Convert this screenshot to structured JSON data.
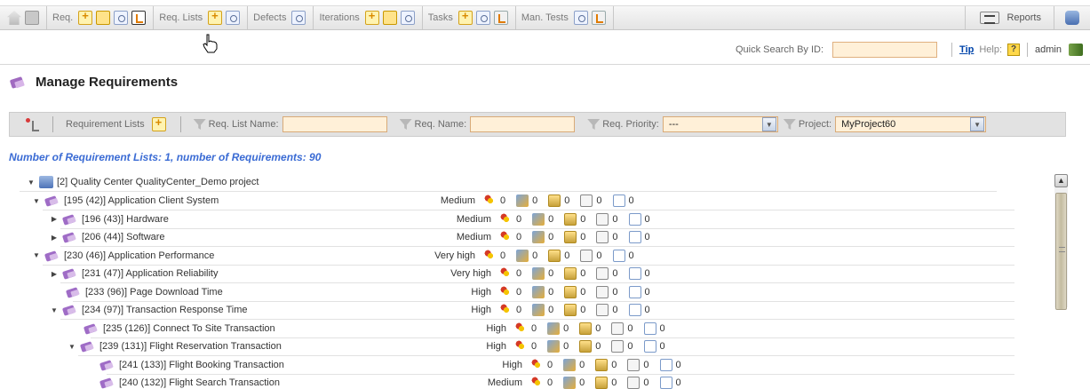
{
  "toolbar": {
    "req_label": "Req.",
    "req_lists_label": "Req. Lists",
    "defects_label": "Defects",
    "iterations_label": "Iterations",
    "tasks_label": "Tasks",
    "man_tests_label": "Man. Tests",
    "reports_label": "Reports"
  },
  "quick_search": {
    "label": "Quick Search By ID:",
    "value": "",
    "tip_label": "Tip",
    "help_label": "Help:",
    "help_icon": "?",
    "user": "admin"
  },
  "page": {
    "title": "Manage Requirements"
  },
  "filters": {
    "requirement_lists_label": "Requirement Lists",
    "req_list_name_label": "Req. List Name:",
    "req_name_label": "Req. Name:",
    "req_priority_label": "Req. Priority:",
    "req_priority_value": "---",
    "project_label": "Project:",
    "project_value": "MyProject60"
  },
  "summary": "Number of Requirement Lists: 1, number of Requirements: 90",
  "tree": {
    "root": "[2] Quality Center QualityCenter_Demo project",
    "rows": [
      {
        "label": "[195 (42)] Application Client System",
        "priority": "Medium",
        "defects": "0",
        "tests": "0",
        "tasks": "0",
        "runs": "0",
        "docs": "0"
      },
      {
        "label": "[196 (43)] Hardware",
        "priority": "Medium",
        "defects": "0",
        "tests": "0",
        "tasks": "0",
        "runs": "0",
        "docs": "0"
      },
      {
        "label": "[206 (44)] Software",
        "priority": "Medium",
        "defects": "0",
        "tests": "0",
        "tasks": "0",
        "runs": "0",
        "docs": "0"
      },
      {
        "label": "[230 (46)] Application Performance",
        "priority": "Very high",
        "defects": "0",
        "tests": "0",
        "tasks": "0",
        "runs": "0",
        "docs": "0"
      },
      {
        "label": "[231 (47)] Application Reliability",
        "priority": "Very high",
        "defects": "0",
        "tests": "0",
        "tasks": "0",
        "runs": "0",
        "docs": "0"
      },
      {
        "label": "[233 (96)] Page Download Time",
        "priority": "High",
        "defects": "0",
        "tests": "0",
        "tasks": "0",
        "runs": "0",
        "docs": "0"
      },
      {
        "label": "[234 (97)] Transaction Response Time",
        "priority": "High",
        "defects": "0",
        "tests": "0",
        "tasks": "0",
        "runs": "0",
        "docs": "0"
      },
      {
        "label": "[235 (126)] Connect To Site Transaction",
        "priority": "High",
        "defects": "0",
        "tests": "0",
        "tasks": "0",
        "runs": "0",
        "docs": "0"
      },
      {
        "label": "[239 (131)] Flight Reservation Transaction",
        "priority": "High",
        "defects": "0",
        "tests": "0",
        "tasks": "0",
        "runs": "0",
        "docs": "0"
      },
      {
        "label": "[241 (133)] Flight Booking Transaction",
        "priority": "High",
        "defects": "0",
        "tests": "0",
        "tasks": "0",
        "runs": "0",
        "docs": "0"
      },
      {
        "label": "[240 (132)] Flight Search Transaction",
        "priority": "Medium",
        "defects": "0",
        "tests": "0",
        "tasks": "0",
        "runs": "0",
        "docs": "0"
      }
    ]
  }
}
